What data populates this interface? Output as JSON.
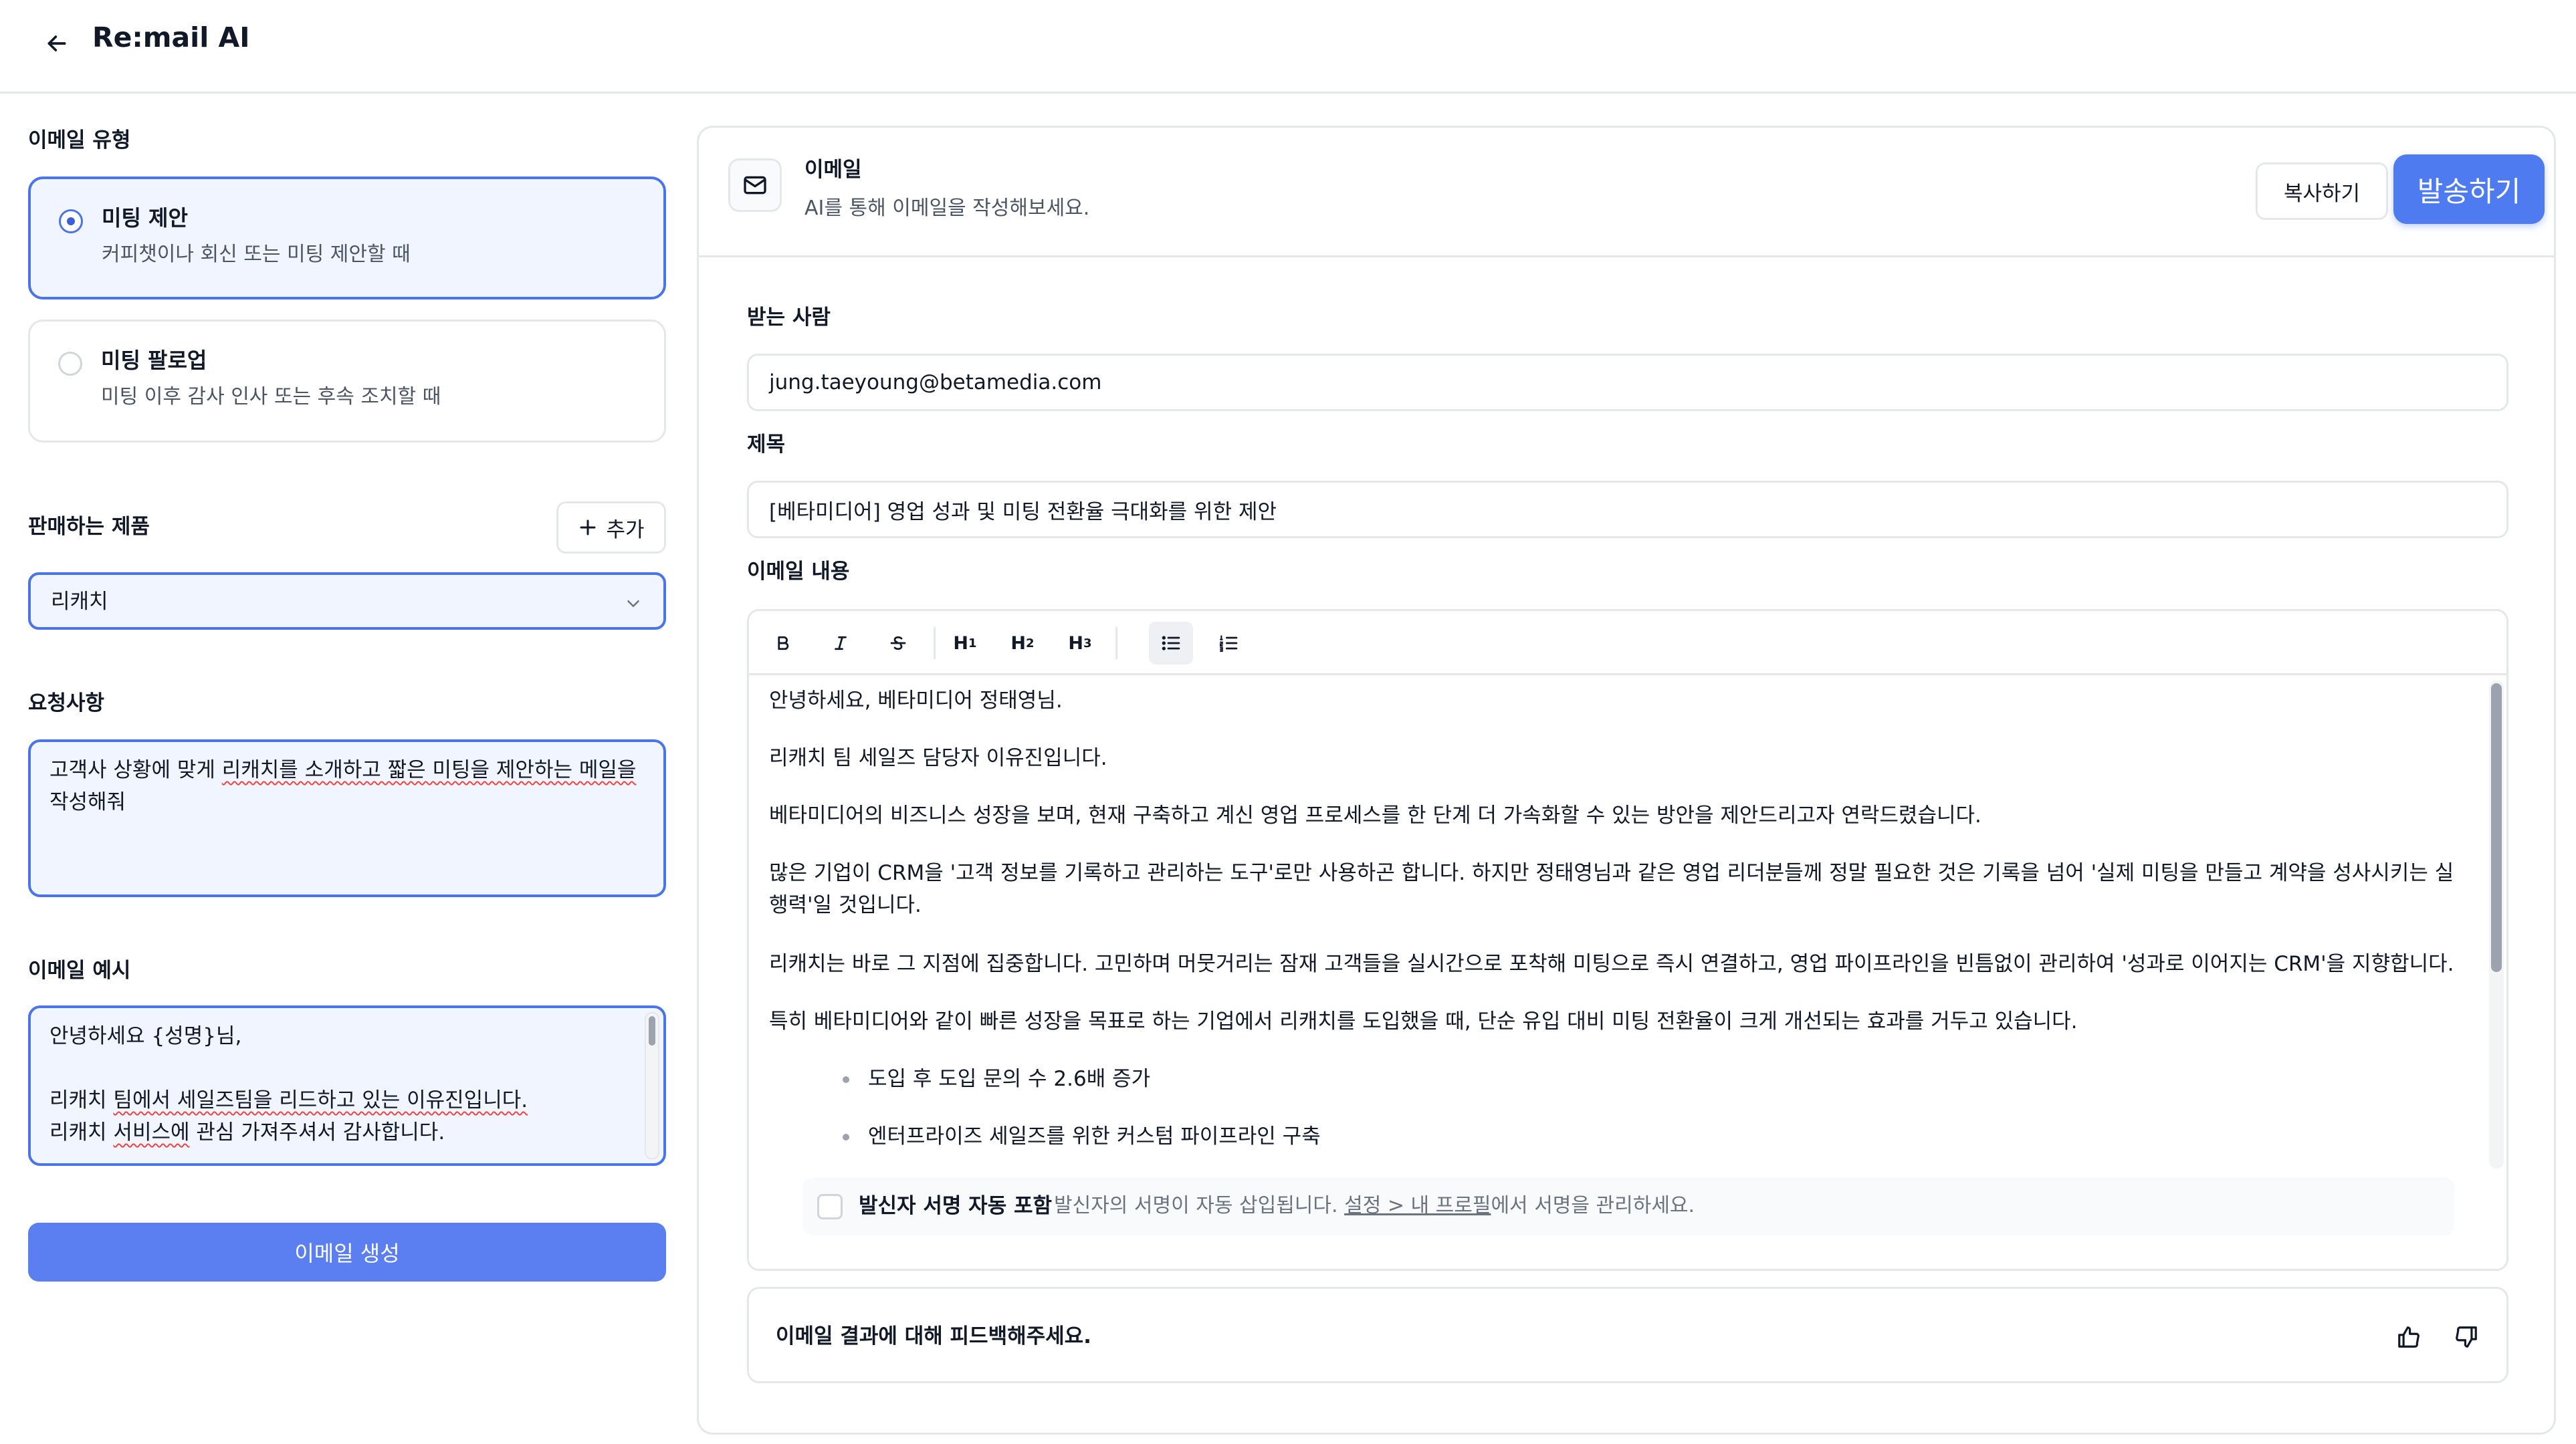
{
  "app": {
    "title": "Re:mail AI"
  },
  "left": {
    "email_type": {
      "label": "이메일 유형",
      "options": [
        {
          "title": "미팅 제안",
          "desc": "커피챗이나 회신 또는 미팅 제안할 때",
          "selected": true
        },
        {
          "title": "미팅 팔로업",
          "desc": "미팅 이후 감사 인사 또는 후속 조치할 때",
          "selected": false
        }
      ]
    },
    "product": {
      "label": "판매하는 제품",
      "add_label": "추가",
      "selected": "리캐치"
    },
    "request": {
      "label": "요청사항",
      "value_a": "고객사 상황에 맞게 ",
      "value_b": "리캐치를 소개하고 짧은 미팅을 제안하는 메일을",
      "value_c": "작성해줘"
    },
    "example": {
      "label": "이메일 예시",
      "line1": "안녕하세요 {성명}님,",
      "line2a": "리캐치 ",
      "line2b": "팀에서 세일즈팀을 리드하고 있는 이유진입니다.",
      "line3a": "리캐치 ",
      "line3b": "서비스에",
      "line3c": " 관심 가져주셔서 감사합니다."
    },
    "generate_label": "이메일 생성"
  },
  "panel": {
    "title": "이메일",
    "subtitle": "AI를 통해 이메일을 작성해보세요.",
    "copy_label": "복사하기",
    "send_label": "발송하기",
    "to_label": "받는 사람",
    "to_value": "jung.taeyoung@betamedia.com",
    "subject_label": "제목",
    "subject_value": "[베타미디어] 영업 성과 및 미팅 전환율 극대화를 위한 제안",
    "body_label": "이메일 내용",
    "toolbar": {
      "h1": "H",
      "h1s": "1",
      "h2": "H",
      "h2s": "2",
      "h3": "H",
      "h3s": "3"
    },
    "body": {
      "p1": "안녕하세요, 베타미디어 정태영님.",
      "p2": "리캐치 팀 세일즈 담당자 이유진입니다.",
      "p3": "베타미디어의 비즈니스 성장을 보며, 현재 구축하고 계신 영업 프로세스를 한 단계 더 가속화할 수 있는 방안을 제안드리고자 연락드렸습니다.",
      "p4": "많은 기업이 CRM을 '고객 정보를 기록하고 관리하는 도구'로만 사용하곤 합니다. 하지만 정태영님과 같은 영업 리더분들께 정말 필요한 것은 기록을 넘어 '실제 미팅을 만들고 계약을 성사시키는 실행력'일 것입니다.",
      "p5": "리캐치는 바로 그 지점에 집중합니다. 고민하며 머뭇거리는 잠재 고객들을 실시간으로 포착해 미팅으로 즉시 연결하고, 영업 파이프라인을 빈틈없이 관리하여 '성과로 이어지는 CRM'을 지향합니다.",
      "p6": "특히 베타미디어와 같이 빠른 성장을 목표로 하는 기업에서 리캐치를 도입했을 때, 단순 유입 대비 미팅 전환율이 크게 개선되는 효과를 거두고 있습니다.",
      "b1": "도입 후 도입 문의 수 2.6배 증가",
      "b2": "엔터프라이즈 세일즈를 위한 커스텀 파이프라인 구축"
    },
    "signature": {
      "label": "발신자 서명 자동 포함",
      "hint_a": "발신자의 서명이 자동 삽입됩니다. ",
      "hint_link": "설정 > 내 프로필",
      "hint_b": "에서 서명을 관리하세요."
    },
    "feedback_label": "이메일 결과에 대해 피드백해주세요."
  },
  "colors": {
    "accent": "#4f7bf0",
    "accent_bg": "#f1f5ff",
    "border": "#e5e7eb"
  }
}
